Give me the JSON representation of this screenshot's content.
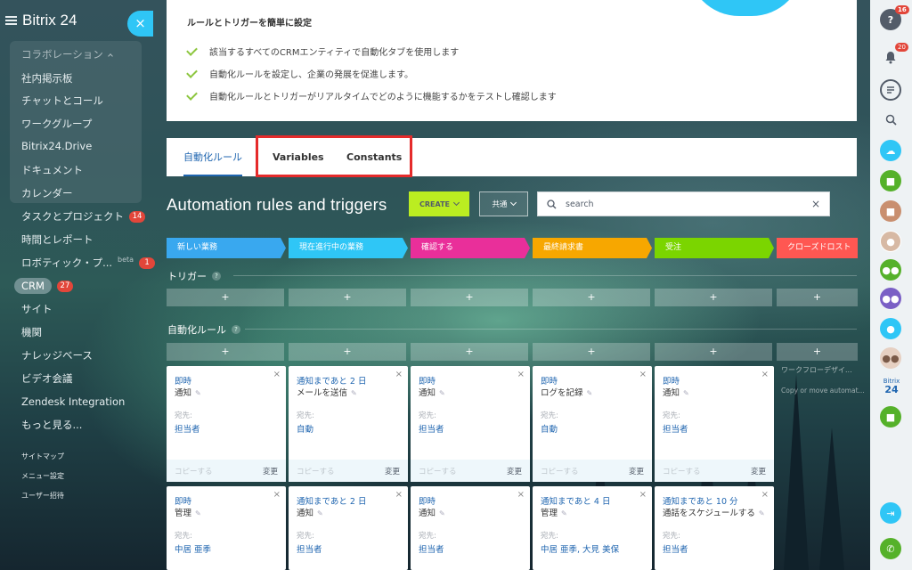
{
  "sidebar": {
    "brand": "Bitrix 24",
    "collapse_icon": "×",
    "group_label": "コラボレーション",
    "items": [
      {
        "label": "社内掲示板"
      },
      {
        "label": "チャットとコール"
      },
      {
        "label": "ワークグループ"
      },
      {
        "label": "Bitrix24.Drive"
      },
      {
        "label": "ドキュメント"
      },
      {
        "label": "カレンダー"
      },
      {
        "label": "タスクとプロジェクト",
        "counter": "14"
      },
      {
        "label": "時間とレポート"
      },
      {
        "label": "ロボティック・プ...",
        "beta": "beta",
        "counter": "1"
      },
      {
        "label": "CRM",
        "counter": "27"
      },
      {
        "label": "サイト"
      },
      {
        "label": "機関"
      },
      {
        "label": "ナレッジベース"
      },
      {
        "label": "ビデオ会議"
      },
      {
        "label": "Zendesk Integration"
      },
      {
        "label": "もっと見る..."
      }
    ],
    "bottom_links": [
      "サイトマップ",
      "メニュー設定",
      "ユーザー招待"
    ]
  },
  "intro": {
    "heading": "ルールとトリガーを簡単に設定",
    "points": [
      "該当するすべてのCRMエンティティで自動化タブを使用します",
      "自動化ルールを設定し、企業の発展を促進します。",
      "自動化ルールとトリガーがリアルタイムでどのように機能するかをテストし確認します"
    ]
  },
  "tabs": {
    "rules": "自動化ルール",
    "variables": "Variables",
    "constants": "Constants"
  },
  "toolbar": {
    "title": "Automation rules and triggers",
    "create_label": "CREATE",
    "common_label": "共通",
    "search_placeholder": "search",
    "clear_icon": "×"
  },
  "stages": [
    {
      "label": "新しい業務",
      "color": "#39a8ef"
    },
    {
      "label": "現在進行中の業務",
      "color": "#2fc6f6"
    },
    {
      "label": "確認する",
      "color": "#e92f9a"
    },
    {
      "label": "最終請求書",
      "color": "#f7a700"
    },
    {
      "label": "受注",
      "color": "#7bd500"
    },
    {
      "label": "クローズドロスト",
      "color": "#ff5752"
    }
  ],
  "sections": {
    "triggers": "トリガー",
    "rules": "自動化ルール",
    "help": "?",
    "add": "+"
  },
  "workflow": {
    "design": "ワークフローデザイ...",
    "copy": "Copy or move automat..."
  },
  "card_common": {
    "to_label": "宛先:",
    "copy": "コピーする",
    "edit": "変更",
    "close": "×",
    "pencil": "✎"
  },
  "cards_row1": [
    {
      "when": "即時",
      "action": "通知",
      "to": "担当者"
    },
    {
      "when": "通知まであと 2 日",
      "action": "メールを送信",
      "to": "自動"
    },
    {
      "when": "即時",
      "action": "通知",
      "to": "担当者"
    },
    {
      "when": "即時",
      "action": "ログを記録",
      "to": "自動"
    },
    {
      "when": "即時",
      "action": "通知",
      "to": "担当者"
    }
  ],
  "cards_row2": [
    {
      "when": "即時",
      "action": "管理",
      "to": "中居 亜季"
    },
    {
      "when": "通知まであと 2 日",
      "action": "通知",
      "to": "担当者"
    },
    {
      "when": "即時",
      "action": "通知",
      "to": "担当者"
    },
    {
      "when": "通知まであと 4 日",
      "action": "管理",
      "to": "中居 亜季, 大見 美保"
    },
    {
      "when": "通知まであと 10 分",
      "action": "通話をスケジュールする",
      "to": "担当者"
    }
  ],
  "rightbar": {
    "help_badge": "16",
    "bell_badge": "20",
    "logo_top": "Bitrix",
    "logo_bottom": "24"
  }
}
